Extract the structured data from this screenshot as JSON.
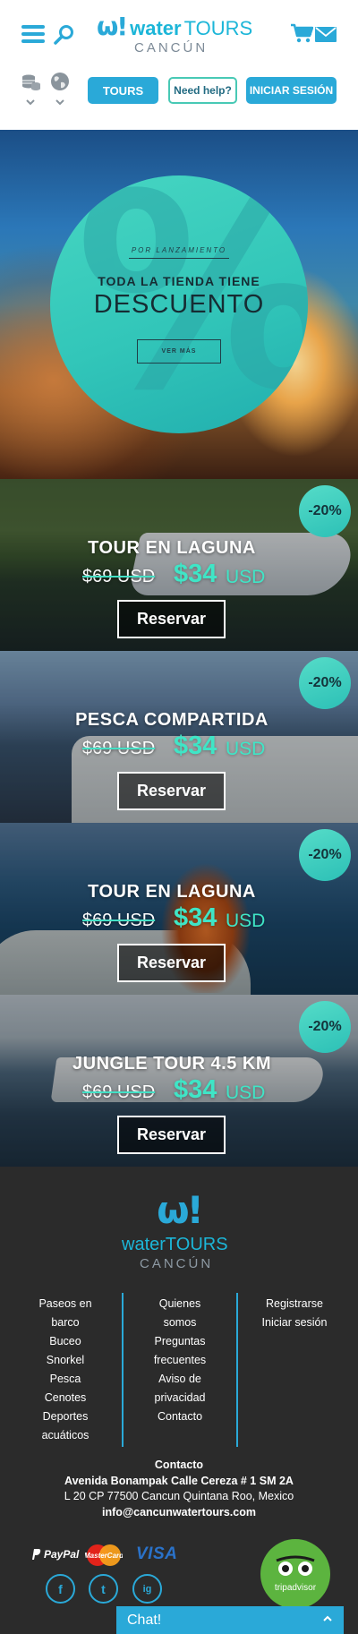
{
  "header": {
    "logo": {
      "word1": "water",
      "word2": "TOURS",
      "city": "CANCÚN"
    },
    "nav": {
      "tours": "TOURS",
      "help": "Need help?",
      "login": "INICIAR SESIÓN"
    },
    "icons": [
      "menu-icon",
      "search-icon",
      "cart-icon",
      "mail-icon",
      "coins-icon",
      "globe-icon",
      "chevron-down-icon"
    ],
    "accent": "#2aa9d8"
  },
  "hero": {
    "kicker": "POR LANZAMIENTO",
    "title1": "TODA LA TIENDA TIENE",
    "title2": "DESCUENTO",
    "cta": "VER MÁS",
    "symbol": "%",
    "circle_color": "#3bcdbd"
  },
  "tours": [
    {
      "name": "TOUR EN LAGUNA",
      "old_price": "$69 USD",
      "price": "$34",
      "currency": "USD",
      "discount": "-20%",
      "cta": "Reservar"
    },
    {
      "name": "PESCA COMPARTIDA",
      "old_price": "$69 USD",
      "price": "$34",
      "currency": "USD",
      "discount": "-20%",
      "cta": "Reservar"
    },
    {
      "name": "TOUR EN LAGUNA",
      "old_price": "$69 USD",
      "price": "$34",
      "currency": "USD",
      "discount": "-20%",
      "cta": "Reservar"
    },
    {
      "name": "JUNGLE TOUR 4.5 KM",
      "old_price": "$69 USD",
      "price": "$34",
      "currency": "USD",
      "discount": "-20%",
      "cta": "Reservar"
    }
  ],
  "footer": {
    "logo": {
      "word1": "water",
      "word2": "TOURS",
      "city": "CANCÚN"
    },
    "col1": [
      "Paseos en",
      "barco",
      "Buceo",
      "Snorkel",
      "Pesca",
      "Cenotes",
      "Deportes",
      "acuáticos"
    ],
    "col2": [
      "Quienes",
      "somos",
      "Preguntas",
      "frecuentes",
      "Aviso de",
      "privacidad",
      "Contacto"
    ],
    "col3": [
      "Registrarse",
      "Iniciar sesión"
    ],
    "contact": {
      "heading": "Contacto",
      "address1": "Avenida Bonampak Calle Cereza # 1 SM 2A",
      "address2": "L 20 CP 77500 Cancun Quintana Roo, Mexico",
      "email": "info@cancunwatertours.com"
    },
    "payments": {
      "paypal": "PayPal",
      "mastercard": "MasterCard",
      "visa": "VISA"
    },
    "social": {
      "facebook": "f",
      "twitter": "t",
      "instagram": "ig"
    },
    "tripadvisor": "tripadvisor",
    "chat": "Chat!"
  }
}
